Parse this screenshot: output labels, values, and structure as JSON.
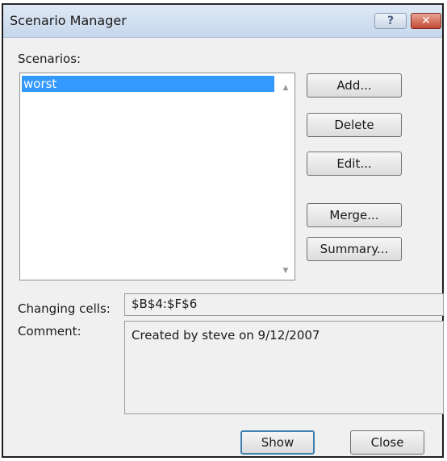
{
  "dialog": {
    "title": "Scenario Manager",
    "help_glyph": "?",
    "close_glyph": "✕"
  },
  "scenarios": {
    "label": "Scenarios:",
    "items": [
      "worst"
    ],
    "scroll_up_glyph": "▲",
    "scroll_down_glyph": "▼"
  },
  "buttons": {
    "add": "Add...",
    "delete": "Delete",
    "edit": "Edit...",
    "merge": "Merge...",
    "summary": "Summary..."
  },
  "details": {
    "changing_cells_label": "Changing cells:",
    "changing_cells_value": "$B$4:$F$6",
    "comment_label": "Comment:",
    "comment_value": "Created by steve on 9/12/2007"
  },
  "footer": {
    "show": "Show",
    "close": "Close"
  }
}
